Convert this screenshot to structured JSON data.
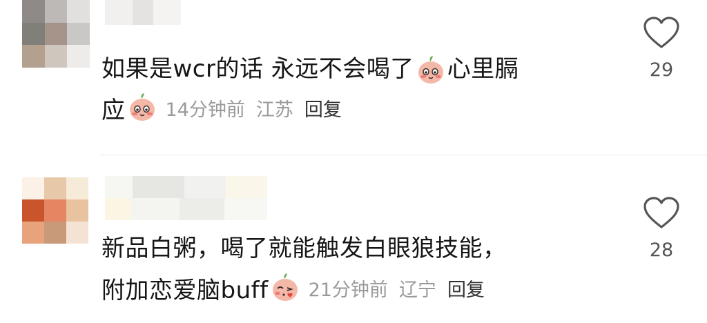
{
  "comments": [
    {
      "text_line1_a": "如果是wcr的话 永远不会喝了",
      "text_line1_b": "心里膈",
      "text_line2": "应",
      "emoji_1": "blushing-peach-emoji",
      "emoji_2": "blushing-peach-emoji",
      "time": "14分钟前",
      "location": "江苏",
      "reply_label": "回复",
      "like_icon": "heart-outline-icon",
      "like_count": "29"
    },
    {
      "text_line1": "新品白粥，喝了就能触发白眼狼技能，",
      "text_line2": "附加恋爱脑buff",
      "emoji_1": "kiss-peach-emoji",
      "time": "21分钟前",
      "location": "辽宁",
      "reply_label": "回复",
      "like_icon": "heart-outline-icon",
      "like_count": "28"
    }
  ],
  "colors": {
    "text": "#161616",
    "meta": "#9a9a9a",
    "reply": "#333333",
    "divider": "#e9e9e9",
    "like_icon": "#555555"
  }
}
